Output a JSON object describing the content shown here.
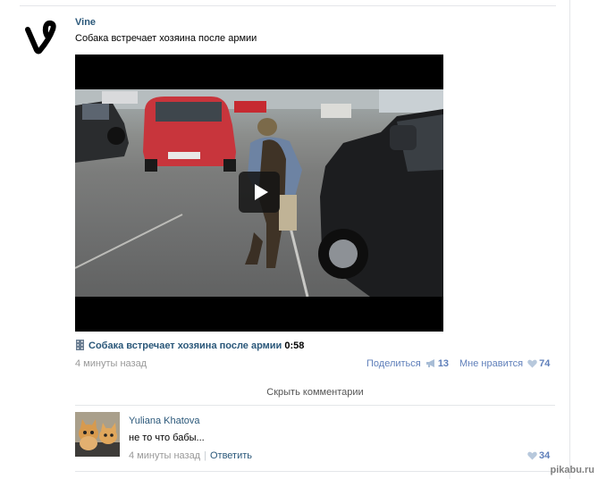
{
  "post": {
    "author": "Vine",
    "text": "Собака встречает хозяина после армии",
    "video_title": "Собака встречает хозяина после армии",
    "video_duration": "0:58",
    "time": "4 минуты назад",
    "share_label": "Поделиться",
    "share_count": "13",
    "like_label": "Мне нравится",
    "like_count": "74"
  },
  "comments_toggle": "Скрыть комментарии",
  "comment": {
    "author": "Yuliana Khatova",
    "text": "не то что бабы...",
    "time": "4 минуты назад",
    "reply_label": "Ответить",
    "like_count": "34"
  },
  "watermark": "pikabu.ru",
  "colors": {
    "link": "#2b587a",
    "muted_link": "#5f7fba",
    "muted_text": "#999999"
  }
}
